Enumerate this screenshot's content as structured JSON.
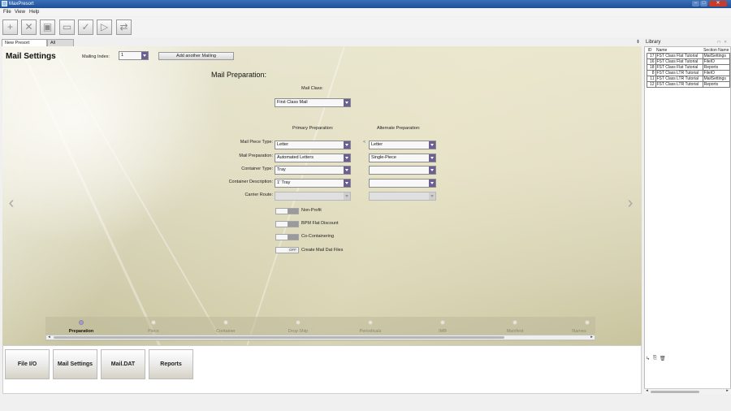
{
  "window": {
    "title": "MaxPresort",
    "min": "–",
    "max": "□",
    "close": "✕"
  },
  "menu": [
    "File",
    "View",
    "Help"
  ],
  "toolbar": [
    {
      "name": "new-icon",
      "glyph": "+"
    },
    {
      "name": "delete-icon",
      "glyph": "✕"
    },
    {
      "name": "save-icon",
      "glyph": "▣"
    },
    {
      "name": "print-icon",
      "glyph": "▭"
    },
    {
      "name": "check-icon",
      "glyph": "✓"
    },
    {
      "name": "run-icon",
      "glyph": "▷"
    },
    {
      "name": "refresh-icon",
      "glyph": "⇄"
    }
  ],
  "tabs": [
    {
      "label": "New Presort Job",
      "close": "✕"
    },
    {
      "label": "All Jobs",
      "close": "✕"
    }
  ],
  "mail_settings": {
    "title": "Mail Settings",
    "mailing_index_label": "Mailing Index:",
    "mailing_index_value": "1",
    "add_mailing": "Add another Mailing",
    "section_title": "Mail Preparation:",
    "mail_class_label": "Mail Class:",
    "mail_class_value": "First Class Mail",
    "primary_header": "Primary Preparation:",
    "alternate_header": "Alternate Preparation:",
    "rows": [
      {
        "label": "Mail Piece Type:",
        "primary": "Letter",
        "alternate": "Letter"
      },
      {
        "label": "Mail Preparation:",
        "primary": "Automated Letters",
        "alternate": "Single-Piece"
      },
      {
        "label": "Container Type:",
        "primary": "Tray",
        "alternate": ""
      },
      {
        "label": "Container Description:",
        "primary": "1' Tray",
        "alternate": ""
      },
      {
        "label": "Carrier Route:",
        "primary": "",
        "alternate": ""
      }
    ],
    "copy_arrow": "<",
    "toggles": [
      {
        "label": "Non-Profit"
      },
      {
        "label": "BPM Flat Discount"
      },
      {
        "label": "Co-Containering"
      },
      {
        "label": "Create Mail Dat Files",
        "state": "OFF"
      }
    ],
    "prev_arrow": "‹",
    "next_arrow": "›"
  },
  "steps": [
    "Preparation",
    "Piece",
    "Container",
    "Drop Ship",
    "Periodicals",
    "IMB",
    "Manifest",
    "Names"
  ],
  "step_scroll": {
    "left": "◂",
    "right": "▸"
  },
  "bottom_buttons": [
    "File I/O",
    "Mail Settings",
    "Mail.DAT",
    "Reports"
  ],
  "library": {
    "title": "Library",
    "columns": [
      "ID",
      "Name",
      "Section Name"
    ],
    "rows": [
      {
        "id": "17",
        "name": "FST Class Flat Tutorial",
        "section": "MailSettings"
      },
      {
        "id": "16",
        "name": "FST Class Flat Tutorial",
        "section": "FileIO"
      },
      {
        "id": "18",
        "name": "FST Class Flat Tutorial",
        "section": "Reports"
      },
      {
        "id": "8",
        "name": "FST Class LTR Tutorial",
        "section": "FileIO"
      },
      {
        "id": "11",
        "name": "FST Class LTR Tutorial",
        "section": "MailSettings"
      },
      {
        "id": "12",
        "name": "FST Class LTR Tutorial",
        "section": "Reports"
      }
    ],
    "scroll_left": "◂",
    "scroll_right": "▸"
  }
}
